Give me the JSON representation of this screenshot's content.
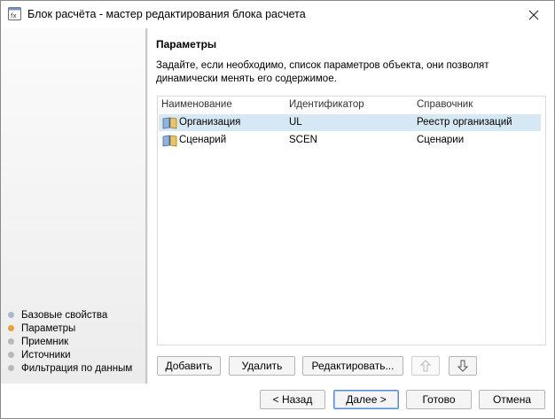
{
  "window": {
    "title": "Блок расчёта - мастер редактирования блока расчета",
    "icon": "calculation-block-icon"
  },
  "nav": {
    "items": [
      {
        "label": "Базовые свойства",
        "state": "inactive",
        "color": "#a9b8cc"
      },
      {
        "label": "Параметры",
        "state": "active",
        "color": "#f0a030"
      },
      {
        "label": "Приемник",
        "state": "inactive",
        "color": "#b8b8b8"
      },
      {
        "label": "Источники",
        "state": "inactive",
        "color": "#b8b8b8"
      },
      {
        "label": "Фильтрация по данным",
        "state": "inactive",
        "color": "#b8b8b8"
      }
    ]
  },
  "content": {
    "title": "Параметры",
    "description": "Задайте, если необходимо, список параметров объекта, они позволят динамически менять его содержимое."
  },
  "table": {
    "headers": [
      "Наименование",
      "Идентификатор",
      "Справочник"
    ],
    "rows": [
      {
        "name": "Организация",
        "id": "UL",
        "dictionary": "Реестр организаций",
        "selected": true,
        "icon": "dictionary-book-icon"
      },
      {
        "name": "Сценарий",
        "id": "SCEN",
        "dictionary": "Сценарии",
        "selected": false,
        "icon": "dictionary-book-icon"
      }
    ]
  },
  "toolbar": {
    "add_label": "Добавить",
    "delete_label": "Удалить",
    "edit_label": "Редактировать...",
    "move_up_icon": "arrow-up-icon",
    "move_down_icon": "arrow-down-icon"
  },
  "footer": {
    "back_label": "< Назад",
    "next_label": "Далее >",
    "done_label": "Готово",
    "cancel_label": "Отмена"
  },
  "colors": {
    "selection": "#d6e8f4",
    "active_step": "#f0a030"
  }
}
